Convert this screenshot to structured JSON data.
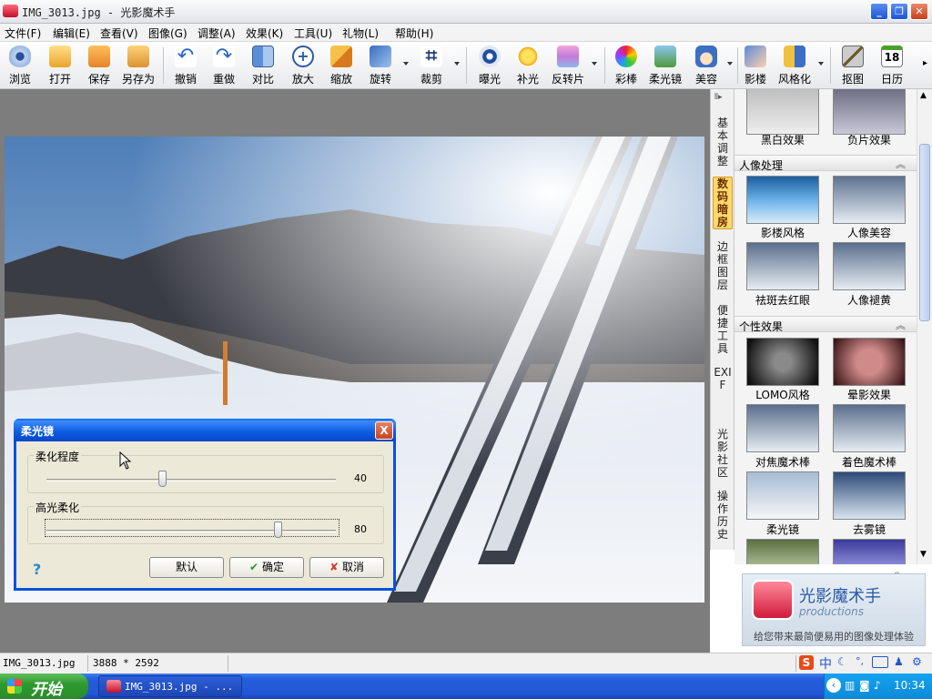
{
  "app": {
    "window_title": "IMG_3013.jpg - 光影魔术手"
  },
  "menu": [
    "文件(F)",
    "编辑(E)",
    "查看(V)",
    "图像(G)",
    "调整(A)",
    "效果(K)",
    "工具(U)",
    "礼物(L)",
    "帮助(H)"
  ],
  "toolbar": [
    {
      "label": "浏览",
      "icon": "eye-icon"
    },
    {
      "label": "打开",
      "icon": "folder-icon"
    },
    {
      "label": "保存",
      "icon": "floppy-icon"
    },
    {
      "label": "另存为",
      "icon": "floppy-save-as-icon"
    },
    {
      "label": "撤销",
      "icon": "undo-icon"
    },
    {
      "label": "重做",
      "icon": "redo-icon"
    },
    {
      "label": "对比",
      "icon": "compare-icon"
    },
    {
      "label": "放大",
      "icon": "zoom-in-icon"
    },
    {
      "label": "缩放",
      "icon": "resize-icon"
    },
    {
      "label": "旋转",
      "icon": "rotate-icon"
    },
    {
      "label": "裁剪",
      "icon": "crop-icon"
    },
    {
      "label": "曝光",
      "icon": "exposure-icon"
    },
    {
      "label": "补光",
      "icon": "fill-light-icon"
    },
    {
      "label": "反转片",
      "icon": "reversal-film-icon"
    },
    {
      "label": "彩棒",
      "icon": "color-wand-icon"
    },
    {
      "label": "柔光镜",
      "icon": "soft-lens-icon"
    },
    {
      "label": "美容",
      "icon": "beauty-face-icon"
    },
    {
      "label": "影楼",
      "icon": "studio-icon"
    },
    {
      "label": "风格化",
      "icon": "stylize-icon"
    },
    {
      "label": "抠图",
      "icon": "cutout-icon"
    },
    {
      "label": "日历",
      "icon": "calendar-icon"
    }
  ],
  "calendar_day": "18",
  "side_tabs": [
    {
      "label": "基本调整",
      "active": false
    },
    {
      "label": "数码暗房",
      "active": true
    },
    {
      "label": "边框图层",
      "active": false
    },
    {
      "label": "便捷工具",
      "active": false
    },
    {
      "label": "EXIF",
      "active": false
    },
    {
      "label": "光影社区",
      "active": false
    },
    {
      "label": "操作历史",
      "active": false
    }
  ],
  "panel": {
    "top_effects": [
      "黑白效果",
      "负片效果"
    ],
    "sections": [
      {
        "title": "人像处理",
        "items": [
          "影楼风格",
          "人像美容",
          "祛斑去红眼",
          "人像褪黄"
        ]
      },
      {
        "title": "个性效果",
        "items": [
          "LOMO风格",
          "晕影效果",
          "对焦魔术棒",
          "着色魔术棒",
          "柔光镜",
          "去雾镜"
        ]
      }
    ],
    "collapse_glyph": "︽"
  },
  "logo": {
    "name": "光影魔术手",
    "sub": "productions",
    "slogan": "给您带来最简便易用的图像处理体验"
  },
  "dialog": {
    "title": "柔光镜",
    "close": "X",
    "sliders": [
      {
        "label": "柔化程度",
        "value": 40,
        "value_text": "40",
        "fraction": 0.4
      },
      {
        "label": "高光柔化",
        "value": 80,
        "value_text": "80",
        "fraction": 0.8
      }
    ],
    "help": "?",
    "buttons": {
      "default": "默认",
      "ok": "确定",
      "cancel": "取消"
    }
  },
  "status": {
    "filename": "IMG_3013.jpg",
    "dimensions": "3888 * 2592"
  },
  "taskbar": {
    "start": "开始",
    "item": "IMG_3013.jpg - ...",
    "ime": "中",
    "clock": "10:34"
  },
  "colors": {
    "xp_blue": "#245edb",
    "start_green": "#2f9a2f",
    "active_tab": "#ffd76a",
    "workspace": "#7d7d7d"
  }
}
